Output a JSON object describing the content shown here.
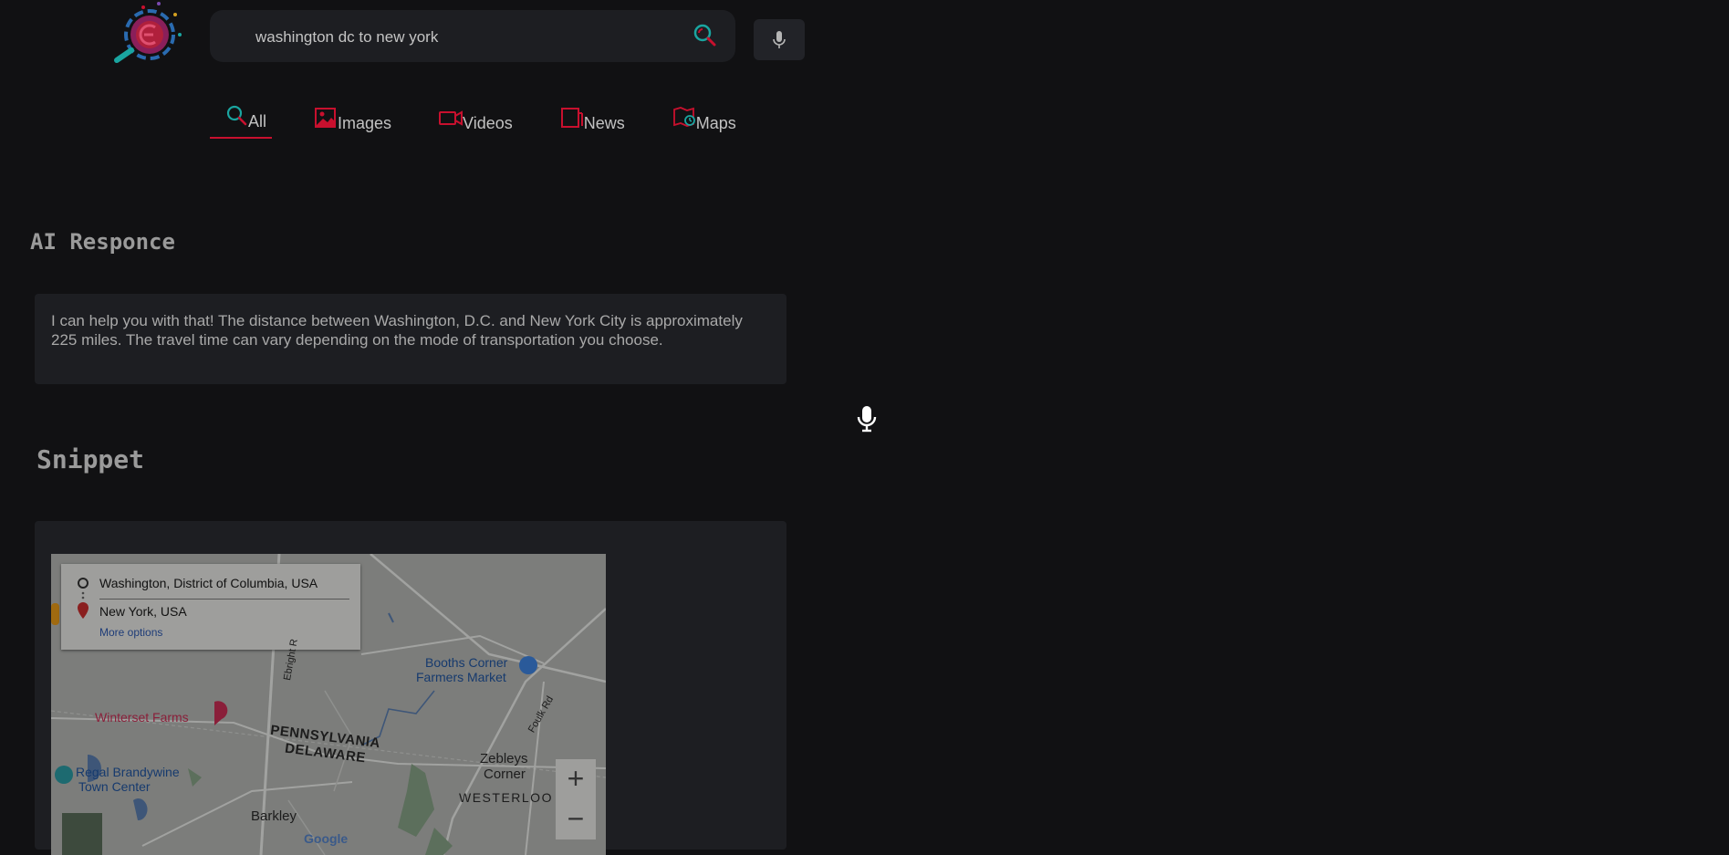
{
  "search": {
    "query": "washington dc to new york"
  },
  "tabs": [
    {
      "label": "All",
      "active": true
    },
    {
      "label": "Images",
      "active": false
    },
    {
      "label": "Videos",
      "active": false
    },
    {
      "label": "News",
      "active": false
    },
    {
      "label": "Maps",
      "active": false
    }
  ],
  "ai": {
    "title": "AI Responce",
    "text": "I can help you with that! The distance between Washington, D.C. and New York City is approximately 225 miles. The travel time can vary depending on the mode of transportation you choose."
  },
  "snippet": {
    "title": "Snippet"
  },
  "map": {
    "origin": "Washington, District of Columbia, USA",
    "destination": "New York, USA",
    "more_options": "More options",
    "labels": {
      "booths_1": "Booths Corner",
      "booths_2": "Farmers Market",
      "winterset": "Winterset Farms",
      "regal_1": "Regal Brandywine",
      "regal_2": "Town Center",
      "pennsylvania": "PENNSYLVANIA",
      "delaware": "DELAWARE",
      "zebleys_1": "Zebleys",
      "zebleys_2": "Corner",
      "westerloo": "WESTERLOO",
      "barkley": "Barkley",
      "foulk_rd": "Foulk Rd",
      "ebright_rd": "Ebright R",
      "google": "Google"
    },
    "zoom_in": "+",
    "zoom_out": "−"
  },
  "colors": {
    "background": "#111113",
    "panel": "#1d1e22",
    "accent": "#c8102e",
    "teal": "#1aa5a0"
  }
}
